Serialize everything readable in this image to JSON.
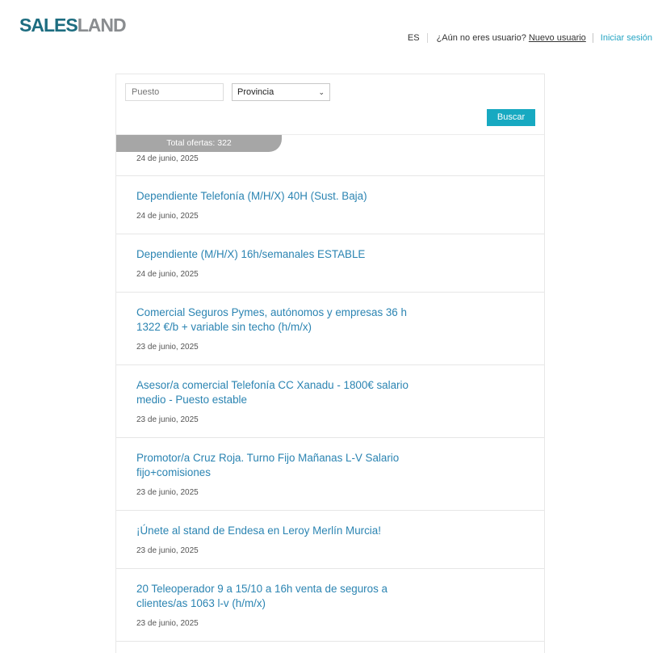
{
  "brand": {
    "part1": "SALES",
    "part2": "LAND"
  },
  "topnav": {
    "lang": "ES",
    "question": "¿Aún no eres usuario?",
    "new_user": "Nuevo usuario",
    "login": "Iniciar sesión"
  },
  "search": {
    "puesto_placeholder": "Puesto",
    "provincia_value": "Provincia",
    "button": "Buscar"
  },
  "results": {
    "total": "Total ofertas: 322",
    "first_date": "24 de junio, 2025",
    "items": [
      {
        "title": "Dependiente Telefonía (M/H/X) 40H (Sust. Baja)",
        "date": "24 de junio, 2025"
      },
      {
        "title": "Dependiente (M/H/X) 16h/semanales ESTABLE",
        "date": "24 de junio, 2025"
      },
      {
        "title": "Comercial Seguros Pymes, autónomos y empresas 36 h 1322 €/b + variable sin techo (h/m/x)",
        "date": "23 de junio, 2025"
      },
      {
        "title": "Asesor/a comercial Telefonía CC Xanadu - 1800€ salario medio - Puesto estable",
        "date": "23 de junio, 2025"
      },
      {
        "title": "Promotor/a Cruz Roja. Turno Fijo Mañanas L-V Salario fijo+comisiones",
        "date": "23 de junio, 2025"
      },
      {
        "title": "¡Únete al stand de Endesa en Leroy Merlín Murcia!",
        "date": "23 de junio, 2025"
      },
      {
        "title": "20 Teleoperador 9 a 15/10 a 16h venta de seguros a clientes/as 1063 l-v (h/m/x)",
        "date": "23 de junio, 2025"
      }
    ]
  }
}
